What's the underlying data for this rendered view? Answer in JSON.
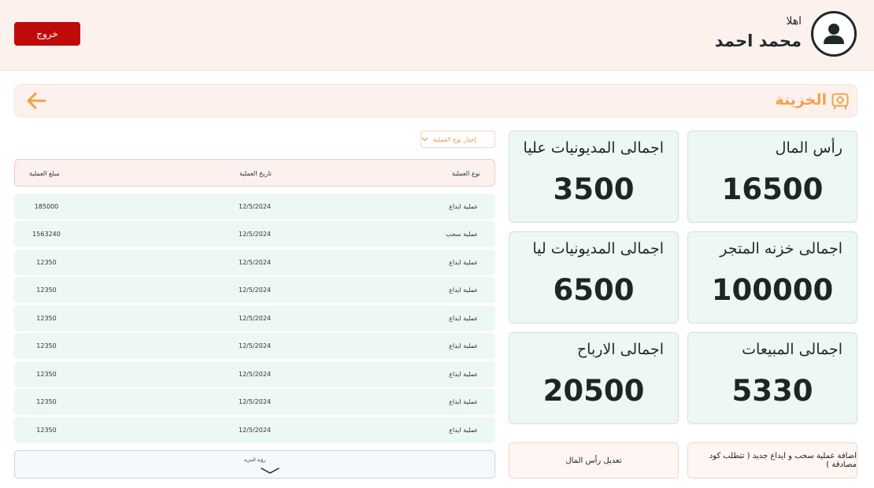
{
  "header": {
    "logout_label": "خروج",
    "greeting": "اهلا",
    "username": "محمد احمد"
  },
  "page": {
    "title": "الخزينة"
  },
  "stats": [
    {
      "label": "رأس المال",
      "value": "16500"
    },
    {
      "label": "اجمالى المديونيات عليا",
      "value": "3500"
    },
    {
      "label": "اجمالى  خزنه المتجر",
      "value": "100000"
    },
    {
      "label": "اجمالى المديونيات ليا",
      "value": "6500"
    },
    {
      "label": "اجمالى المبيعات",
      "value": "5330"
    },
    {
      "label": "اجمالى الارباح",
      "value": "20500"
    }
  ],
  "actions": {
    "add_operation": "اضافة عملية سحب و ايداع جديد ( تتطلب كود مصادقة )",
    "edit_capital": "تعديل رأس المال"
  },
  "filter": {
    "label": "إختار نوع العملية"
  },
  "table": {
    "headers": {
      "type": "نوع العملية",
      "date": "تاريخ العملية",
      "amount": "مبلغ العملية"
    },
    "rows": [
      {
        "type": "عملية ايداع",
        "date": "12/5/2024",
        "amount": "185000"
      },
      {
        "type": "عملية سحب",
        "date": "12/5/2024",
        "amount": "1563240"
      },
      {
        "type": "عملية ايداع",
        "date": "12/5/2024",
        "amount": "12350"
      },
      {
        "type": "عملية ايداع",
        "date": "12/5/2024",
        "amount": "12350"
      },
      {
        "type": "عملية ايداع",
        "date": "12/5/2024",
        "amount": "12350"
      },
      {
        "type": "عملية ايداع",
        "date": "12/5/2024",
        "amount": "12350"
      },
      {
        "type": "عملية ايداع",
        "date": "12/5/2024",
        "amount": "12350"
      },
      {
        "type": "عملية ايداع",
        "date": "12/5/2024",
        "amount": "12350"
      },
      {
        "type": "عملية ايداع",
        "date": "12/5/2024",
        "amount": "12350"
      }
    ],
    "more_label": "رؤيه المزيد"
  },
  "colors": {
    "header_bg": "#fdf1ee",
    "logout_bg": "#c00a0a",
    "accent": "#f0a34a",
    "card_bg": "#ecf8f1"
  },
  "icons": {
    "avatar": "user-avatar-icon",
    "back": "arrow-left-icon",
    "title": "safe-icon",
    "dropdown": "chevron-down-icon",
    "more": "chevron-down-icon"
  }
}
